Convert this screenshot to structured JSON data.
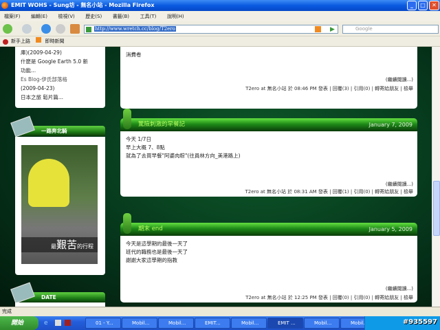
{
  "window": {
    "title": "EMIT WOHS - Sung坊 - 無名小站 - Mozilla Firefox"
  },
  "menu": [
    "檔案(F)",
    "編輯(E)",
    "檢視(V)",
    "歷史(S)",
    "書籤(B)",
    "工具(T)",
    "說明(H)"
  ],
  "nav": {
    "url": "http://www.wretch.cc/blog/T2ero",
    "search_placeholder": "Google"
  },
  "bookmarks": [
    "新手上路",
    "即時新聞"
  ],
  "sidebar": {
    "recent_lines": [
      "庫)(2009-04-29)",
      "什麼是 Google Earth 5.0 新",
      "功能...",
      "Es Blog-伊氏部落格",
      "(2009-04-23)",
      "日本之旅 鬆片篇..."
    ],
    "album_title": "一路奔北騎",
    "photo_caption_pre": "最",
    "photo_caption_big": "艱苦",
    "photo_caption_post": "的行程",
    "date_title": "DATE"
  },
  "posts": [
    {
      "body": [
        "消費卷"
      ],
      "more": "(繼續閱讀...)",
      "meta": "T2ero at 無名小站 於 08:46 PM 發表 | 回覆(3) | 引用(0) | 轉寄給朋友 | 檢舉"
    },
    {
      "title": "驚險刺激的早餐記",
      "date": "January 7, 2009",
      "body": [
        "今天 1/7日",
        "早上大概 7、8點",
        "就為了去買早餐\"阿婆肉粽\"(往員林方向_美港路上)"
      ],
      "more": "(繼續閱讀...)",
      "meta": "T2ero at 無名小站 於 08:31 AM 發表 | 回覆(1) | 引用(0) | 轉寄給朋友 | 檢舉"
    },
    {
      "title": "期末 end",
      "date": "January 5, 2009",
      "body": [
        "今天是這學期的最後一天了",
        "班代的職務也是最後一天了",
        "謝謝大家這學期的指教"
      ],
      "more": "(繼續閱讀...)",
      "meta": "T2ero at 無名小站 於 12:25 PM 發表 | 回覆(0) | 引用(0) | 轉寄給朋友 | 檢舉"
    }
  ],
  "status": "完成",
  "taskbar": {
    "start": "開始",
    "tasks": [
      "01 - Y...",
      "Mobil...",
      "Mobil...",
      "EMIT...",
      "Mobil...",
      "EMIT ...",
      "Mobil...",
      "Mobil..."
    ],
    "active_index": 5,
    "clock": "#935597"
  }
}
